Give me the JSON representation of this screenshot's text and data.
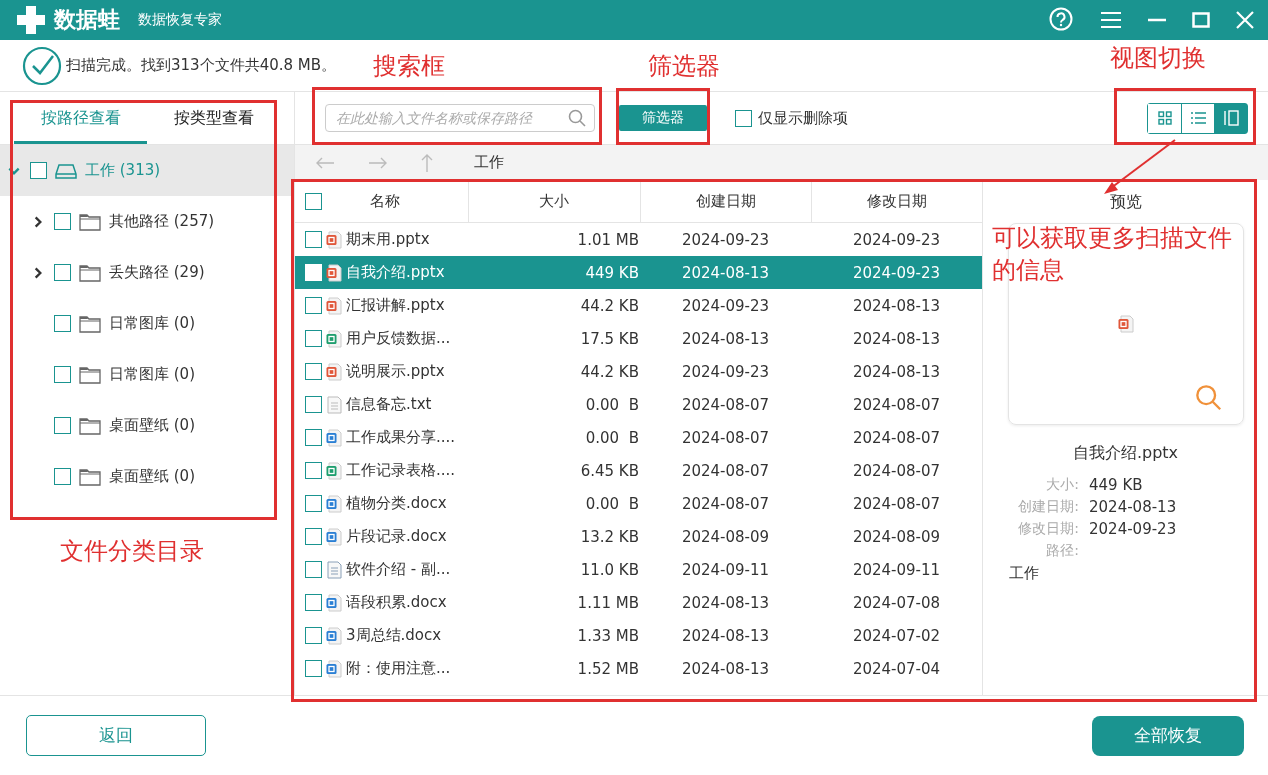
{
  "app": {
    "logo_text": "数据蛙",
    "subtitle": "数据恢复专家"
  },
  "status": "扫描完成。找到313个文件共40.8 MB。",
  "tabs": [
    {
      "label": "按路径查看",
      "selected": true
    },
    {
      "label": "按类型查看",
      "selected": false
    }
  ],
  "tree": [
    {
      "label": "工作 (313)",
      "kind": "drive",
      "checked": false,
      "selected": true,
      "expanded": true,
      "children": [
        {
          "label": "其他路径 (257)",
          "kind": "folder",
          "checked": false,
          "selected": false,
          "expanded": false
        },
        {
          "label": "丢失路径 (29)",
          "kind": "folder",
          "checked": false,
          "selected": false,
          "expanded": false
        },
        {
          "label": "日常图库 (0)",
          "kind": "folder",
          "checked": false,
          "selected": false
        },
        {
          "label": "日常图库 (0)",
          "kind": "folder",
          "checked": false,
          "selected": false
        },
        {
          "label": "桌面壁纸 (0)",
          "kind": "folder",
          "checked": false,
          "selected": false
        },
        {
          "label": "桌面壁纸 (0)",
          "kind": "folder",
          "checked": false,
          "selected": false
        }
      ]
    }
  ],
  "search": {
    "placeholder": "在此处输入文件名称或保存路径"
  },
  "filter_button": "筛选器",
  "deleted_only": {
    "label": "仅显示删除项",
    "checked": false
  },
  "views": [
    {
      "kind": "grid",
      "selected": false
    },
    {
      "kind": "list",
      "selected": false
    },
    {
      "kind": "preview",
      "selected": true
    }
  ],
  "path": "工作",
  "table": {
    "columns": [
      "名称",
      "大小",
      "创建日期",
      "修改日期"
    ],
    "all_checked": false,
    "rows": [
      {
        "name": "期末用.pptx",
        "kind": "pptx",
        "size": "1.01 MB",
        "created": "2024-09-23",
        "modified": "2024-09-23",
        "checked": false,
        "selected": false
      },
      {
        "name": "自我介绍.pptx",
        "kind": "pptx",
        "size": "449 KB",
        "created": "2024-08-13",
        "modified": "2024-09-23",
        "checked": false,
        "selected": true
      },
      {
        "name": "汇报讲解.pptx",
        "kind": "pptx",
        "size": "44.2 KB",
        "created": "2024-09-23",
        "modified": "2024-08-13",
        "checked": false,
        "selected": false
      },
      {
        "name": "用户反馈数据...",
        "kind": "xlsx",
        "size": "17.5 KB",
        "created": "2024-08-13",
        "modified": "2024-08-13",
        "checked": false,
        "selected": false
      },
      {
        "name": "说明展示.pptx",
        "kind": "pptx",
        "size": "44.2 KB",
        "created": "2024-09-23",
        "modified": "2024-08-13",
        "checked": false,
        "selected": false
      },
      {
        "name": "信息备忘.txt",
        "kind": "txt",
        "size": "0.00  B",
        "created": "2024-08-07",
        "modified": "2024-08-07",
        "checked": false,
        "selected": false
      },
      {
        "name": "工作成果分享....",
        "kind": "docx",
        "size": "0.00  B",
        "created": "2024-08-07",
        "modified": "2024-08-07",
        "checked": false,
        "selected": false
      },
      {
        "name": "工作记录表格....",
        "kind": "xlsx",
        "size": "6.45 KB",
        "created": "2024-08-07",
        "modified": "2024-08-07",
        "checked": false,
        "selected": false
      },
      {
        "name": "植物分类.docx",
        "kind": "docx",
        "size": "0.00  B",
        "created": "2024-08-07",
        "modified": "2024-08-07",
        "checked": false,
        "selected": false
      },
      {
        "name": "片段记录.docx",
        "kind": "docx",
        "size": "13.2 KB",
        "created": "2024-08-09",
        "modified": "2024-08-09",
        "checked": false,
        "selected": false
      },
      {
        "name": "软件介绍 - 副...",
        "kind": "doc",
        "size": "11.0 KB",
        "created": "2024-09-11",
        "modified": "2024-09-11",
        "checked": false,
        "selected": false
      },
      {
        "name": "语段积累.docx",
        "kind": "docx",
        "size": "1.11 MB",
        "created": "2024-08-13",
        "modified": "2024-07-08",
        "checked": false,
        "selected": false
      },
      {
        "name": "3周总结.docx",
        "kind": "docx",
        "size": "1.33 MB",
        "created": "2024-08-13",
        "modified": "2024-07-02",
        "checked": false,
        "selected": false
      },
      {
        "name": "附：使用注意...",
        "kind": "docx",
        "size": "1.52 MB",
        "created": "2024-08-13",
        "modified": "2024-07-04",
        "checked": false,
        "selected": false
      }
    ]
  },
  "preview": {
    "title": "预览",
    "kind": "pptx",
    "file_name": "自我介绍.pptx",
    "fields": [
      {
        "label": "大小:",
        "value": "449 KB"
      },
      {
        "label": "创建日期:",
        "value": "2024-08-13"
      },
      {
        "label": "修改日期:",
        "value": "2024-09-23"
      }
    ],
    "path_label": "路径:",
    "path_value": "工作"
  },
  "buttons": {
    "back": "返回",
    "recover": "全部恢复"
  },
  "annotations": [
    {
      "label": "搜索框"
    },
    {
      "label": "筛选器"
    },
    {
      "label": "视图切换"
    },
    {
      "label": "文件分类目录"
    },
    {
      "label": "可以获取更多扫描文件的信息"
    }
  ]
}
